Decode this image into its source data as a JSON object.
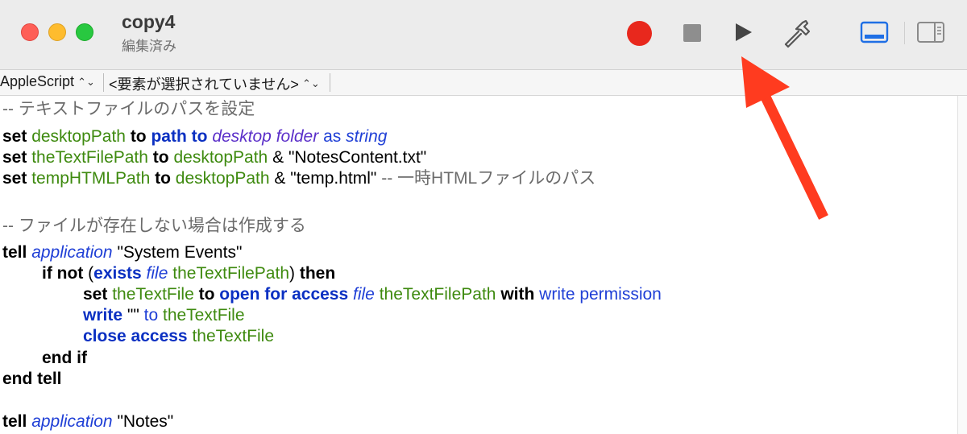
{
  "window": {
    "title": "copy4",
    "subtitle": "編集済み"
  },
  "toolbar": {
    "record_icon": "record-icon",
    "stop_icon": "stop-icon",
    "run_icon": "play-icon",
    "compile_icon": "hammer-icon",
    "view_bottom_icon": "bottom-panel-icon",
    "view_side_icon": "side-panel-icon"
  },
  "navbar": {
    "language": "AppleScript",
    "element": "<要素が選択されていません>"
  },
  "code": {
    "l1_comment": "-- テキストファイルのパスを設定",
    "l2_set": "set",
    "l2_var": "desktopPath",
    "l2_to": "to",
    "l2_path": "path to",
    "l2_desktop": "desktop folder",
    "l2_as": "as",
    "l2_string": "string",
    "l3_set": "set",
    "l3_var": "theTextFilePath",
    "l3_to": "to",
    "l3_var2": "desktopPath",
    "l3_amp": "&",
    "l3_str": "\"NotesContent.txt\"",
    "l4_set": "set",
    "l4_var": "tempHTMLPath",
    "l4_to": "to",
    "l4_var2": "desktopPath",
    "l4_amp": "&",
    "l4_str": "\"temp.html\"",
    "l4_comment": "-- 一時HTMLファイルのパス",
    "l5_comment": "-- ファイルが存在しない場合は作成する",
    "l6_tell": "tell",
    "l6_app": "application",
    "l6_str": "\"System Events\"",
    "l7_if": "if not",
    "l7_paren": "(",
    "l7_exists": "exists",
    "l7_file": "file",
    "l7_var": "theTextFilePath",
    "l7_paren2": ")",
    "l7_then": "then",
    "l8_set": "set",
    "l8_var": "theTextFile",
    "l8_to": "to",
    "l8_open": "open for access",
    "l8_file": "file",
    "l8_var2": "theTextFilePath",
    "l8_with": "with",
    "l8_perm": "write permission",
    "l9_write": "write",
    "l9_str": "\"\"",
    "l9_to": "to",
    "l9_var": "theTextFile",
    "l10_close": "close access",
    "l10_var": "theTextFile",
    "l11_endif": "end if",
    "l12_endtell": "end tell",
    "l13_tell": "tell",
    "l13_app": "application",
    "l13_str": "\"Notes\""
  },
  "colors": {
    "annotation_arrow": "#ff3b1f",
    "keyword_blue": "#0b30c2",
    "variable_green": "#3e8a0f"
  }
}
